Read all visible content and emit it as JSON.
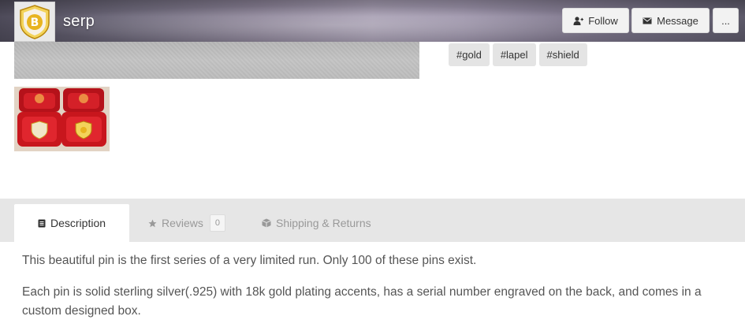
{
  "header": {
    "shop_name": "serp",
    "follow_label": "Follow",
    "message_label": "Message",
    "more_label": "..."
  },
  "tags": [
    "#gold",
    "#lapel",
    "#shield"
  ],
  "tabs": {
    "description": "Description",
    "reviews": "Reviews",
    "reviews_count": "0",
    "shipping": "Shipping & Returns"
  },
  "description": {
    "p1": "This beautiful pin is the first series of a very limited run. Only 100 of these pins exist.",
    "p2": "Each pin is solid sterling silver(.925) with 18k gold plating accents, has a serial number engraved on the back, and comes in a custom designed box."
  },
  "colors": {
    "tab_bar": "#e6e6e6",
    "tag_bg": "#e4e4e4",
    "logo_gold": "#e8b420",
    "box_red": "#c8161d"
  }
}
